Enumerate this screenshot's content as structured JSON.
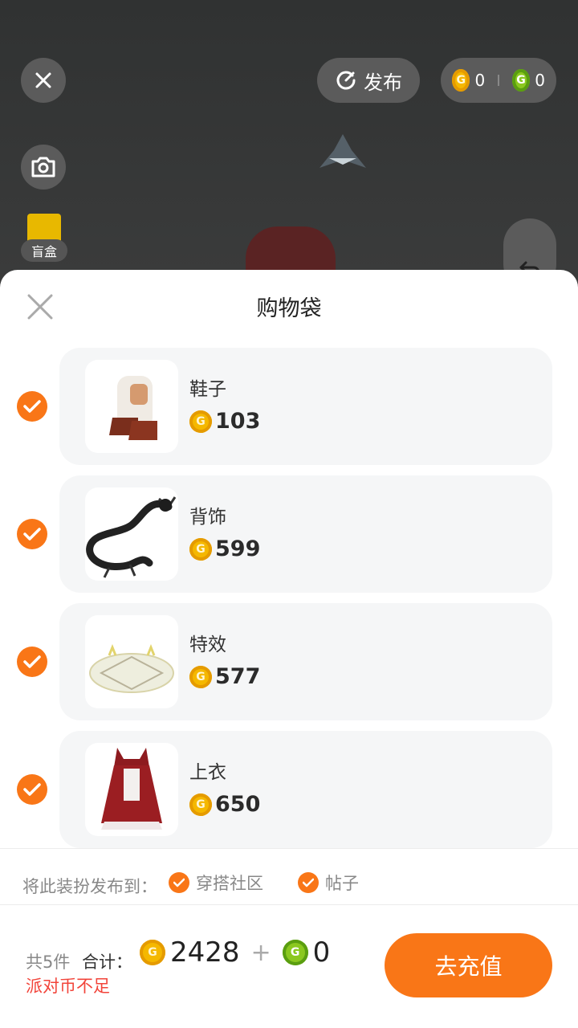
{
  "header": {
    "publish_label": "发布",
    "party_coins": "0",
    "g_coins": "0",
    "blind_box_label": "盲盒"
  },
  "sheet": {
    "title": "购物袋",
    "items": [
      {
        "name": "鞋子",
        "price": "103"
      },
      {
        "name": "背饰",
        "price": "599"
      },
      {
        "name": "特效",
        "price": "577"
      },
      {
        "name": "上衣",
        "price": "650"
      }
    ],
    "publish_to_label": "将此装扮发布到：",
    "publish_options": [
      "穿搭社区",
      "帖子"
    ]
  },
  "footer": {
    "count_text": "共5件",
    "total_label": "合计：",
    "total_party_coins": "2428",
    "plus": "+",
    "total_g_coins": "0",
    "warning": "派对币不足",
    "pay_button": "去充值"
  },
  "colors": {
    "accent": "#f97617",
    "warning": "#f2443a",
    "card_bg": "#f5f6f7"
  }
}
